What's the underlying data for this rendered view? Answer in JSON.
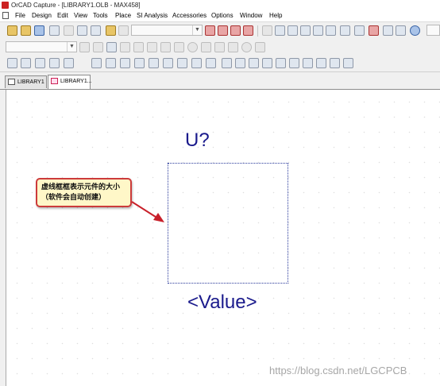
{
  "window": {
    "title": "OrCAD Capture - [LIBRARY1.OLB - MAX458]"
  },
  "menu": {
    "items": [
      "File",
      "Design",
      "Edit",
      "View",
      "Tools",
      "Place",
      "SI Analysis",
      "Accessories",
      "Options",
      "Window",
      "Help"
    ]
  },
  "tabs": [
    {
      "label": "LIBRARY1",
      "active": false
    },
    {
      "label": "LIBRARY1...",
      "active": true
    }
  ],
  "canvas": {
    "reference_designator": "U?",
    "value_label": "<Value>",
    "callout_text": "虚线框框表示元件的大小（软件会自动创建）",
    "watermark": "https://blog.csdn.net/LGCPCB"
  },
  "colors": {
    "part_text": "#1a1a8c",
    "callout_border": "#cc3b3b",
    "callout_bg": "#fff7c8",
    "arrow": "#c8202a"
  },
  "icons": {
    "toolbar1": [
      "new-icon",
      "open-icon",
      "save-icon",
      "print-icon",
      "cut-icon",
      "copy-icon",
      "paste-icon",
      "undo-icon",
      "redo-icon",
      "zoom-in-icon",
      "zoom-out-icon",
      "zoom-area-icon",
      "zoom-all-icon",
      "part-icon",
      "library-icon",
      "netlist-icon",
      "report-icon",
      "bom-icon",
      "drc-icon",
      "annotate-icon",
      "backannotate-icon",
      "cross-probe-icon",
      "help-icon"
    ],
    "toolbar3": [
      "select-icon",
      "snap-grid-icon",
      "pin-icon",
      "pin-array-icon",
      "part-tool-icon",
      "ieee-symbol-icon",
      "line-icon",
      "polyline-icon",
      "rectangle-icon",
      "ellipse-icon",
      "arc-icon",
      "text-icon",
      "align-left-icon",
      "align-center-icon",
      "align-right-icon",
      "align-top-icon",
      "align-middle-icon",
      "align-bottom-icon",
      "distribute-h-icon",
      "distribute-v-icon"
    ]
  }
}
